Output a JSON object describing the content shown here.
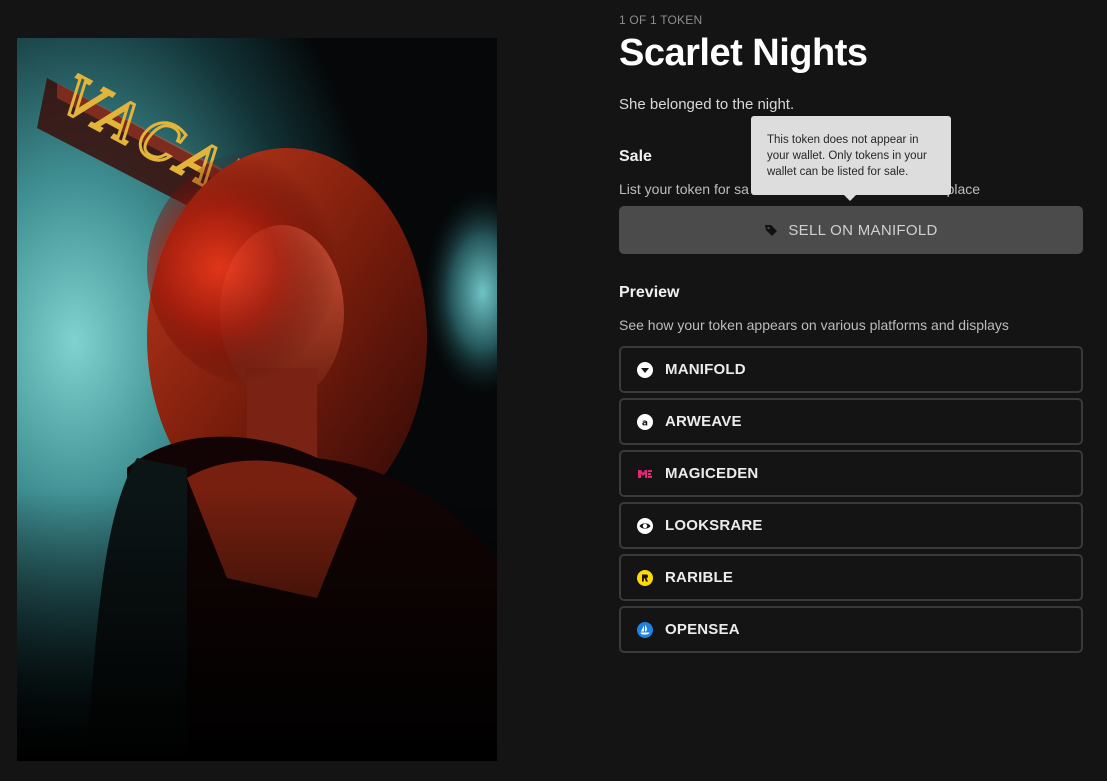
{
  "token": {
    "edition_label": "1 OF 1 TOKEN",
    "title": "Scarlet Nights",
    "description": "She belonged to the night."
  },
  "artwork": {
    "description": "portrait-photo",
    "neon_sign_text": "VACANCY"
  },
  "sale": {
    "heading": "Sale",
    "subtitle_visible_start": "List your token for sa",
    "subtitle_visible_end": "etplace",
    "sell_button_label": "SELL ON MANIFOLD",
    "sell_button_icon": "tag-icon",
    "tooltip": "This token does not appear in your wallet. Only tokens in your wallet can be listed for sale."
  },
  "preview": {
    "heading": "Preview",
    "subtitle": "See how your token appears on various platforms and displays",
    "platforms": [
      {
        "label": "MANIFOLD",
        "icon": "manifold-icon",
        "color": "#ffffff"
      },
      {
        "label": "ARWEAVE",
        "icon": "arweave-icon",
        "color": "#ffffff"
      },
      {
        "label": "MAGICEDEN",
        "icon": "magiceden-icon",
        "color": "#e42575"
      },
      {
        "label": "LOOKSRARE",
        "icon": "looksrare-icon",
        "color": "#ffffff"
      },
      {
        "label": "RARIBLE",
        "icon": "rarible-icon",
        "color": "#feda03"
      },
      {
        "label": "OPENSEA",
        "icon": "opensea-icon",
        "color": "#2081e2"
      }
    ]
  },
  "colors": {
    "background": "#141414",
    "sell_button": "#4b4b4b",
    "tooltip_bg": "#dddddd",
    "border": "#3a3a3a"
  }
}
